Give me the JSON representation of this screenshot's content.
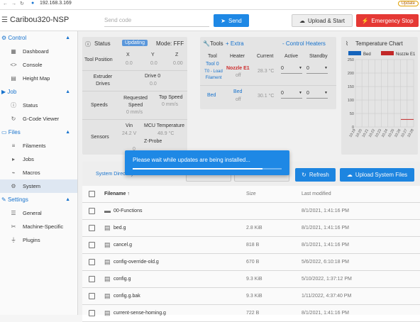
{
  "browser": {
    "url": "192.168.3.169",
    "update_label": "Update"
  },
  "app": {
    "title": "Caribou320-NSP",
    "gcode_placeholder": "Send code",
    "send_label": "Send",
    "upload_start_label": "Upload & Start",
    "emergency_label": "Emergency Stop"
  },
  "sidebar": {
    "control": "Control",
    "dashboard": "Dashboard",
    "console": "Console",
    "heightmap": "Height Map",
    "job": "Job",
    "status": "Status",
    "gcodeviewer": "G-Code Viewer",
    "files": "Files",
    "filaments": "Filaments",
    "jobs": "Jobs",
    "macros": "Macros",
    "system": "System",
    "settings": "Settings",
    "general": "General",
    "machine": "Machine-Specific",
    "plugins": "Plugins"
  },
  "status": {
    "title": "Status",
    "badge": "Updating",
    "mode": "Mode: FFF",
    "tool_position": "Tool Position",
    "x": "X",
    "y": "Y",
    "z": "Z",
    "xv": "0.0",
    "yv": "0.0",
    "zv": "0.00",
    "extruder_drives": "Extruder Drives",
    "drive0": "Drive 0",
    "drive0v": "0.0",
    "speeds": "Speeds",
    "requested_speed": "Requested Speed",
    "requested_v": "0 mm/s",
    "top_speed": "Top Speed",
    "top_v": "0 mm/s",
    "sensors": "Sensors",
    "vin": "Vin",
    "vin_v": "24.2 V",
    "mcu": "MCU Temperature",
    "mcu_v": "48.9 °C",
    "zprobe": "Z-Probe",
    "zprobe_v": "0"
  },
  "tools": {
    "title": "Tools",
    "extra": "+ Extra",
    "control_heaters": "- Control Heaters",
    "h_tool": "Tool",
    "h_heater": "Heater",
    "h_current": "Current",
    "h_active": "Active",
    "h_standby": "Standby",
    "tool0": "Tool 0",
    "tool0_sub": "T0 - Load Filament",
    "nozzle": "Nozzle E1",
    "nozzle_state": "off",
    "nozzle_current": "28.3 °C",
    "nozzle_active": "0",
    "nozzle_standby": "0",
    "bed": "Bed",
    "bed_heater": "Bed",
    "bed_state": "off",
    "bed_current": "30.1 °C",
    "bed_active": "0",
    "bed_standby": "0"
  },
  "temp_chart": {
    "title": "Temperature Chart"
  },
  "chart_data": {
    "type": "line",
    "title": "Temperature Chart",
    "series": [
      {
        "name": "Bed",
        "color": "#1565c0",
        "values": []
      },
      {
        "name": "Nozzle E1",
        "color": "#c62828",
        "values": []
      }
    ],
    "ylim": [
      0,
      250
    ],
    "yticks": [
      "250",
      "200",
      "150",
      "100",
      "50",
      "0"
    ],
    "x": [
      "10:19",
      "10:20",
      "10:21",
      "10:22",
      "10:23",
      "10:24",
      "10:25",
      "10:26",
      "10:27",
      "10:28"
    ],
    "grid": true,
    "legend": "top"
  },
  "files": {
    "breadcrumb": "System Directory",
    "refresh": "Refresh",
    "upload": "Upload System Files",
    "h_name": "Filename",
    "h_size": "Size",
    "h_modified": "Last modified",
    "rows": [
      {
        "name": "00-Functions",
        "size": "",
        "date": "8/1/2021, 1:41:16 PM"
      },
      {
        "name": "bed.g",
        "size": "2.8 KiB",
        "date": "8/1/2021, 1:41:16 PM"
      },
      {
        "name": "cancel.g",
        "size": "818 B",
        "date": "8/1/2021, 1:41:16 PM"
      },
      {
        "name": "config-override-old.g",
        "size": "670 B",
        "date": "5/6/2022, 6:10:18 PM"
      },
      {
        "name": "config.g",
        "size": "9.3 KiB",
        "date": "5/10/2022, 1:37:12 PM"
      },
      {
        "name": "config.g.bak",
        "size": "9.3 KiB",
        "date": "1/11/2022, 4:37:40 PM"
      },
      {
        "name": "current-sense-homing.g",
        "size": "722 B",
        "date": "8/1/2021, 1:41:16 PM"
      }
    ]
  },
  "dialog": {
    "message": "Please wait while updates are being installed...",
    "progress": 0.87
  },
  "colors": {
    "primary": "#1e88e5",
    "danger": "#e53935",
    "active_bg": "#e3ecf7"
  }
}
